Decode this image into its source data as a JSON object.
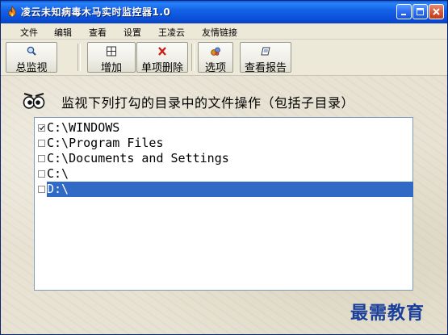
{
  "window": {
    "title": "凌云未知病毒木马实时监控器1.0"
  },
  "menu": {
    "items": [
      "文件",
      "编辑",
      "查看",
      "设置",
      "王凌云",
      "友情链接"
    ]
  },
  "toolbar": {
    "buttons": [
      {
        "label": "总监视",
        "icon": "magnifier-icon"
      },
      {
        "label": "增加",
        "icon": "grid-add-icon"
      },
      {
        "label": "单项删除",
        "icon": "red-x-icon"
      },
      {
        "label": "选项",
        "icon": "options-icon"
      },
      {
        "label": "查看报告",
        "icon": "report-icon"
      }
    ]
  },
  "main": {
    "heading": "监视下列打勾的目录中的文件操作（包括子目录）",
    "directories": [
      {
        "path": "C:\\WINDOWS",
        "checked": true,
        "selected": false
      },
      {
        "path": "C:\\Program Files",
        "checked": false,
        "selected": false
      },
      {
        "path": "C:\\Documents and Settings",
        "checked": false,
        "selected": false
      },
      {
        "path": "C:\\",
        "checked": false,
        "selected": false
      },
      {
        "path": "D:\\",
        "checked": false,
        "selected": true
      }
    ]
  },
  "watermark": "最需教育",
  "colors": {
    "titlebar": "#0a4fd8",
    "selection": "#316ac5",
    "watermark": "#1a3f9a"
  }
}
